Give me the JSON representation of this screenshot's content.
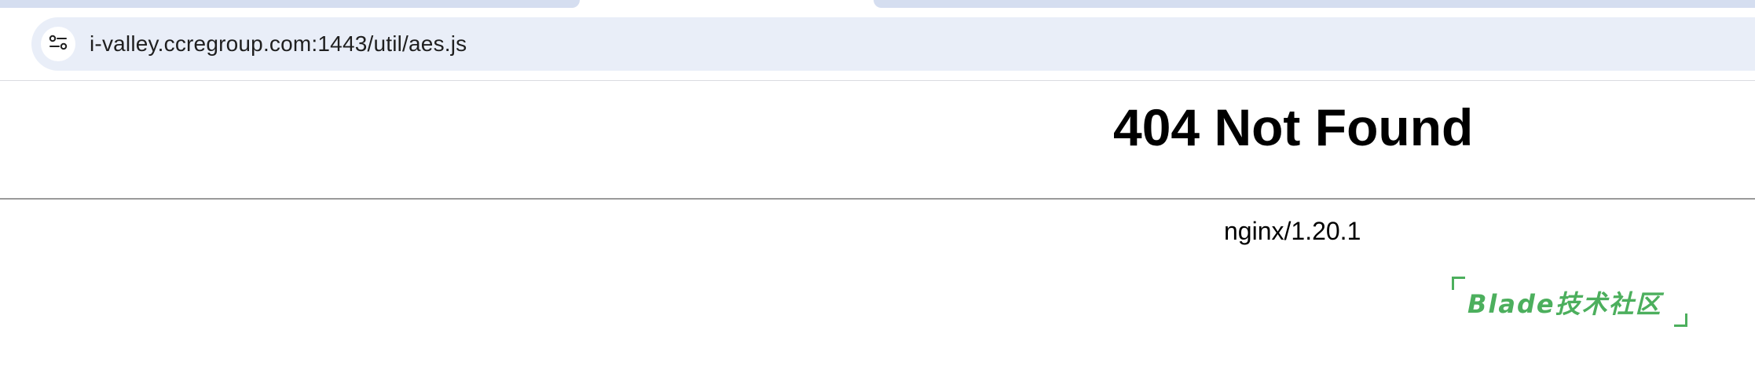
{
  "browser": {
    "address_bar": {
      "url": "i-valley.ccregroup.com:1443/util/aes.js",
      "site_info_icon": "tune-icon"
    }
  },
  "page": {
    "title": "404 Not Found",
    "server_signature": "nginx/1.20.1"
  },
  "watermark": {
    "text": "Blade技术社区",
    "color": "#4caf5d"
  }
}
